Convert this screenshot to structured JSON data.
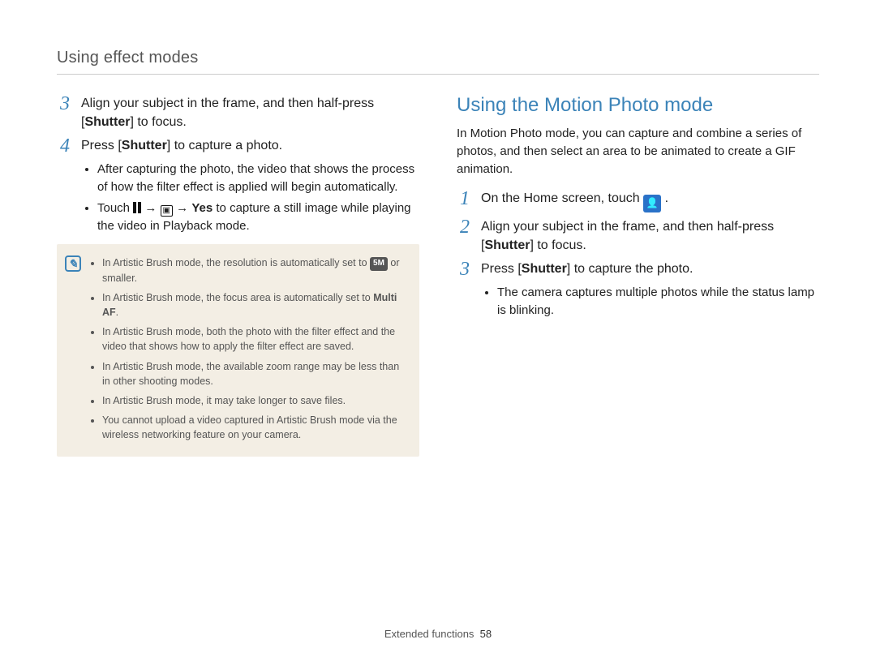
{
  "header": {
    "section_title": "Using effect modes"
  },
  "left": {
    "step3": {
      "num": "3",
      "text_pre": "Align your subject in the frame, and then half-press [",
      "text_bold": "Shutter",
      "text_post": "] to focus."
    },
    "step4": {
      "num": "4",
      "text_pre": "Press [",
      "text_bold": "Shutter",
      "text_post": "] to capture a photo.",
      "bullets": {
        "b1": "After capturing the photo, the video that shows the process of how the filter effect is applied will begin automatically.",
        "b2_pre": "Touch ",
        "b2_arrow1": " → ",
        "b2_arrow2": " → ",
        "b2_yes": "Yes",
        "b2_post": " to capture a still image while playing the video in Playback mode."
      }
    },
    "note": {
      "n1_pre": "In Artistic Brush mode, the resolution is automatically set to ",
      "n1_post": " or smaller.",
      "n2_pre": "In Artistic Brush mode, the focus area is automatically set to ",
      "n2_bold": "Multi AF",
      "n2_post": ".",
      "n3": "In Artistic Brush mode, both the photo with the filter effect and the video that shows how to apply the filter effect are saved.",
      "n4": "In Artistic Brush mode, the available zoom range may be less than in other shooting modes.",
      "n5": "In Artistic Brush mode, it may take longer to save files.",
      "n6": "You cannot upload a video captured in Artistic Brush mode via the wireless networking feature on your camera."
    },
    "icon_5m_label": "5M"
  },
  "right": {
    "heading": "Using the Motion Photo mode",
    "intro": "In Motion Photo mode, you can capture and combine a series of photos, and then select an area to be animated to create a GIF animation.",
    "step1": {
      "num": "1",
      "text_pre": "On the Home screen, touch ",
      "text_post": "."
    },
    "step2": {
      "num": "2",
      "text_pre": "Align your subject in the frame, and then half-press [",
      "text_bold": "Shutter",
      "text_post": "] to focus."
    },
    "step3": {
      "num": "3",
      "text_pre": "Press [",
      "text_bold": "Shutter",
      "text_post": "] to capture the photo.",
      "bullet": "The camera captures multiple photos while the status lamp is blinking."
    }
  },
  "footer": {
    "label": "Extended functions",
    "page": "58"
  }
}
